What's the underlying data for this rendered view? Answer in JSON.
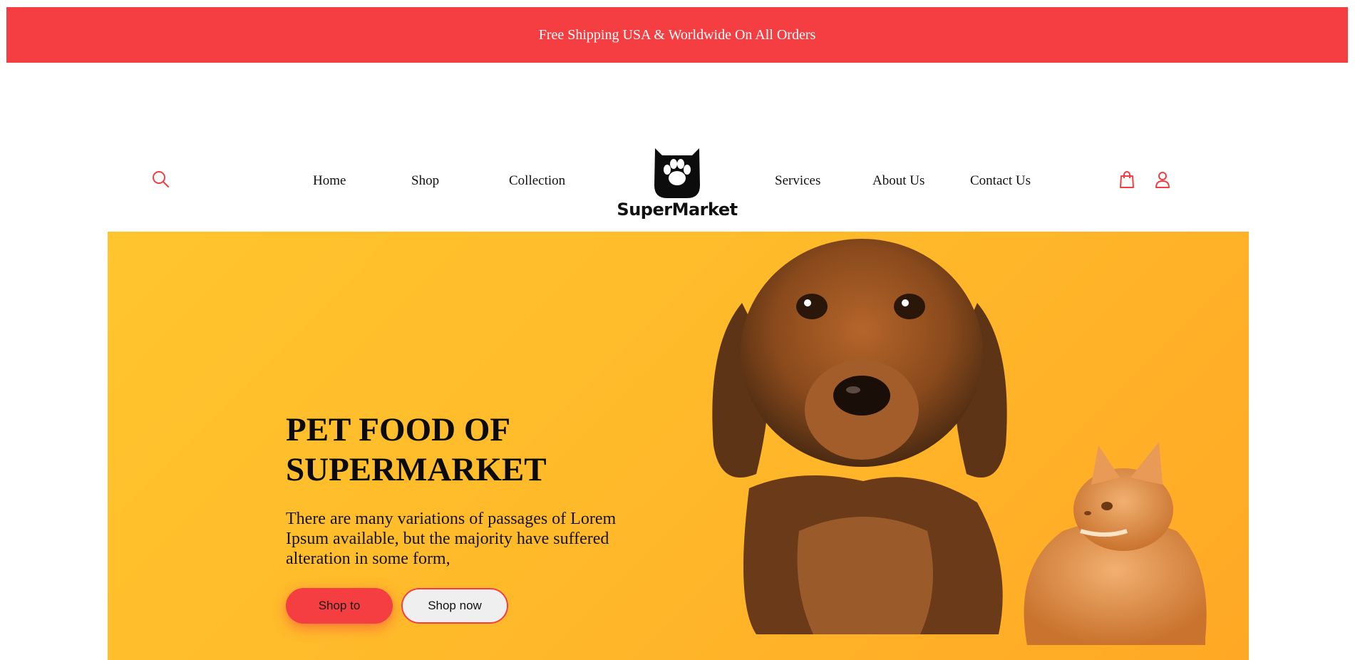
{
  "announcement": {
    "text": "Free Shipping USA & Worldwide On All Orders"
  },
  "header": {
    "nav_left": [
      "Home",
      "Shop",
      "Collection"
    ],
    "nav_right": [
      "Services",
      "About Us",
      "Contact Us"
    ],
    "logo_text": "SuperMarket",
    "icons": {
      "search": "search-icon",
      "cart": "shopping-bag-icon",
      "account": "user-icon"
    }
  },
  "hero": {
    "title": "PET FOOD OF SUPERMARKET",
    "description": "There are many variations of passages of Lorem Ipsum available, but the majority have suffered alteration in some form,",
    "primary_button": "Shop to",
    "secondary_button": "Shop now"
  },
  "colors": {
    "accent": "#f53e41",
    "hero_background": "#ffb92a",
    "text": "#111111"
  }
}
